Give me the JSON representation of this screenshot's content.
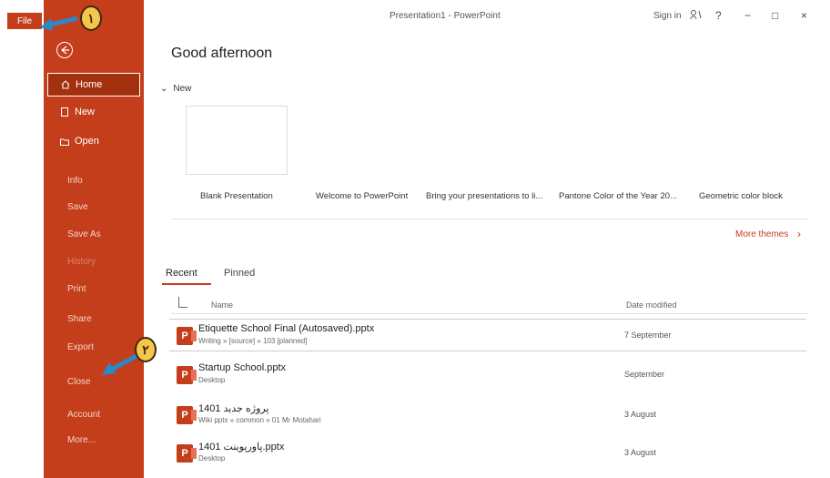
{
  "file_tab": "File",
  "titlebar": {
    "title": "Presentation1 - PowerPoint",
    "signin": "Sign in",
    "buttons": [
      "?",
      "−",
      "□",
      "×"
    ]
  },
  "sidebar": {
    "items": [
      {
        "label": "Home"
      },
      {
        "label": "New"
      },
      {
        "label": "Open"
      }
    ],
    "subitems": [
      "Info",
      "Save",
      "Save As",
      "History",
      "Print",
      "Share",
      "Export",
      "Close",
      "Account",
      "More..."
    ]
  },
  "callouts": [
    "۱",
    "۲"
  ],
  "main": {
    "greeting": "Good afternoon",
    "new_label": "New",
    "templates": [
      "Blank Presentation",
      "Welcome to PowerPoint",
      "Bring your presentations to li...",
      "Pantone Color of the Year 20...",
      "Geometric color block"
    ],
    "more_themes": "More themes",
    "tabs": [
      "Recent",
      "Pinned"
    ],
    "columns": {
      "name": "Name",
      "date": "Date modified"
    },
    "files": [
      {
        "name": "Etiquette School Final (Autosaved).pptx",
        "path": "Writing » [source] » 103 [planned]",
        "date": "7 September"
      },
      {
        "name": "Startup School.pptx",
        "path": "Desktop",
        "date": "September"
      },
      {
        "name": "1401 پروژه جدید",
        "path": "Wiki pptx » common » 01 Mr Motahari",
        "date": "3 August"
      },
      {
        "name": "1401 پاورپوینت.pptx",
        "path": "Desktop",
        "date": "3 August"
      }
    ]
  },
  "colors": {
    "accent": "#c43e1c",
    "accent_dark": "#a3300f",
    "callout": "#f5c64a"
  }
}
